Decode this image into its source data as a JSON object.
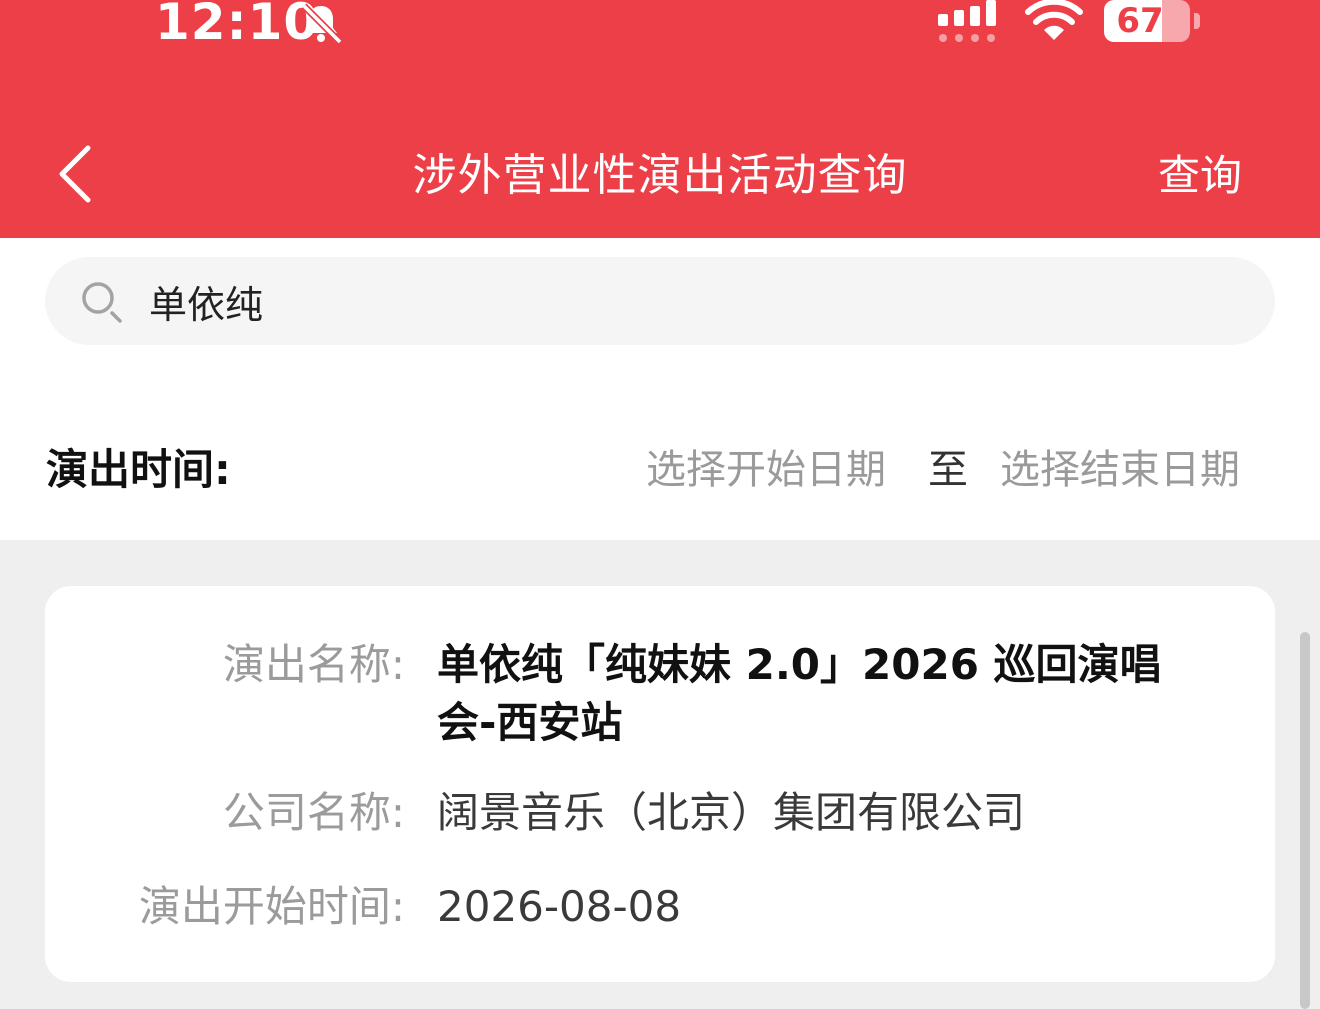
{
  "status_bar": {
    "time": "12:10",
    "battery_percent": "67",
    "battery_level": 0.67,
    "icons": [
      "bell-muted-icon",
      "cellular-signal-icon",
      "wifi-icon",
      "battery-icon"
    ]
  },
  "nav": {
    "back_icon": "chevron-left-icon",
    "title": "涉外营业性演出活动查询",
    "query_label": "查询"
  },
  "search": {
    "icon": "search-icon",
    "value": "单依纯",
    "placeholder": ""
  },
  "date_filter": {
    "label": "演出时间:",
    "start_placeholder": "选择开始日期",
    "separator": "至",
    "end_placeholder": "选择结束日期"
  },
  "results": [
    {
      "name_label": "演出名称:",
      "name_value": "单依纯「纯妹妹 2.0」2026 巡回演唱会-西安站",
      "company_label": "公司名称:",
      "company_value": "阔景音乐（北京）集团有限公司",
      "start_label": "演出开始时间:",
      "start_value": "2026-08-08"
    }
  ],
  "colors": {
    "header_bg": "#ec3f47",
    "page_bg": "#efefef",
    "label_gray": "#9b9b9b"
  }
}
